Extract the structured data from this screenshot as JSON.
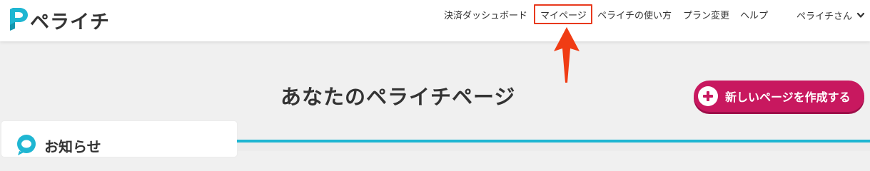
{
  "app": {
    "logo_text": "ペライチ",
    "brand_color": "#1fb6d2",
    "accent_color": "#c8185f"
  },
  "nav": {
    "billing_dashboard": "決済ダッシュボード",
    "my_page": "マイページ",
    "how_to_use": "ペライチの使い方",
    "change_plan": "プラン変更",
    "help": "ヘルプ",
    "user_menu": "ペライチさん",
    "user_menu_icon": "chevron-down-icon"
  },
  "annotation": {
    "highlight_color": "#e8391d",
    "target": "マイページ",
    "arrow_icon": "up-arrow-icon"
  },
  "main": {
    "page_title": "あなたのペライチページ",
    "new_page_button": "新しいページを作成する",
    "new_page_icon": "plus-circle-icon"
  },
  "news": {
    "title": "お知らせ",
    "icon": "speech-bubble-icon"
  }
}
